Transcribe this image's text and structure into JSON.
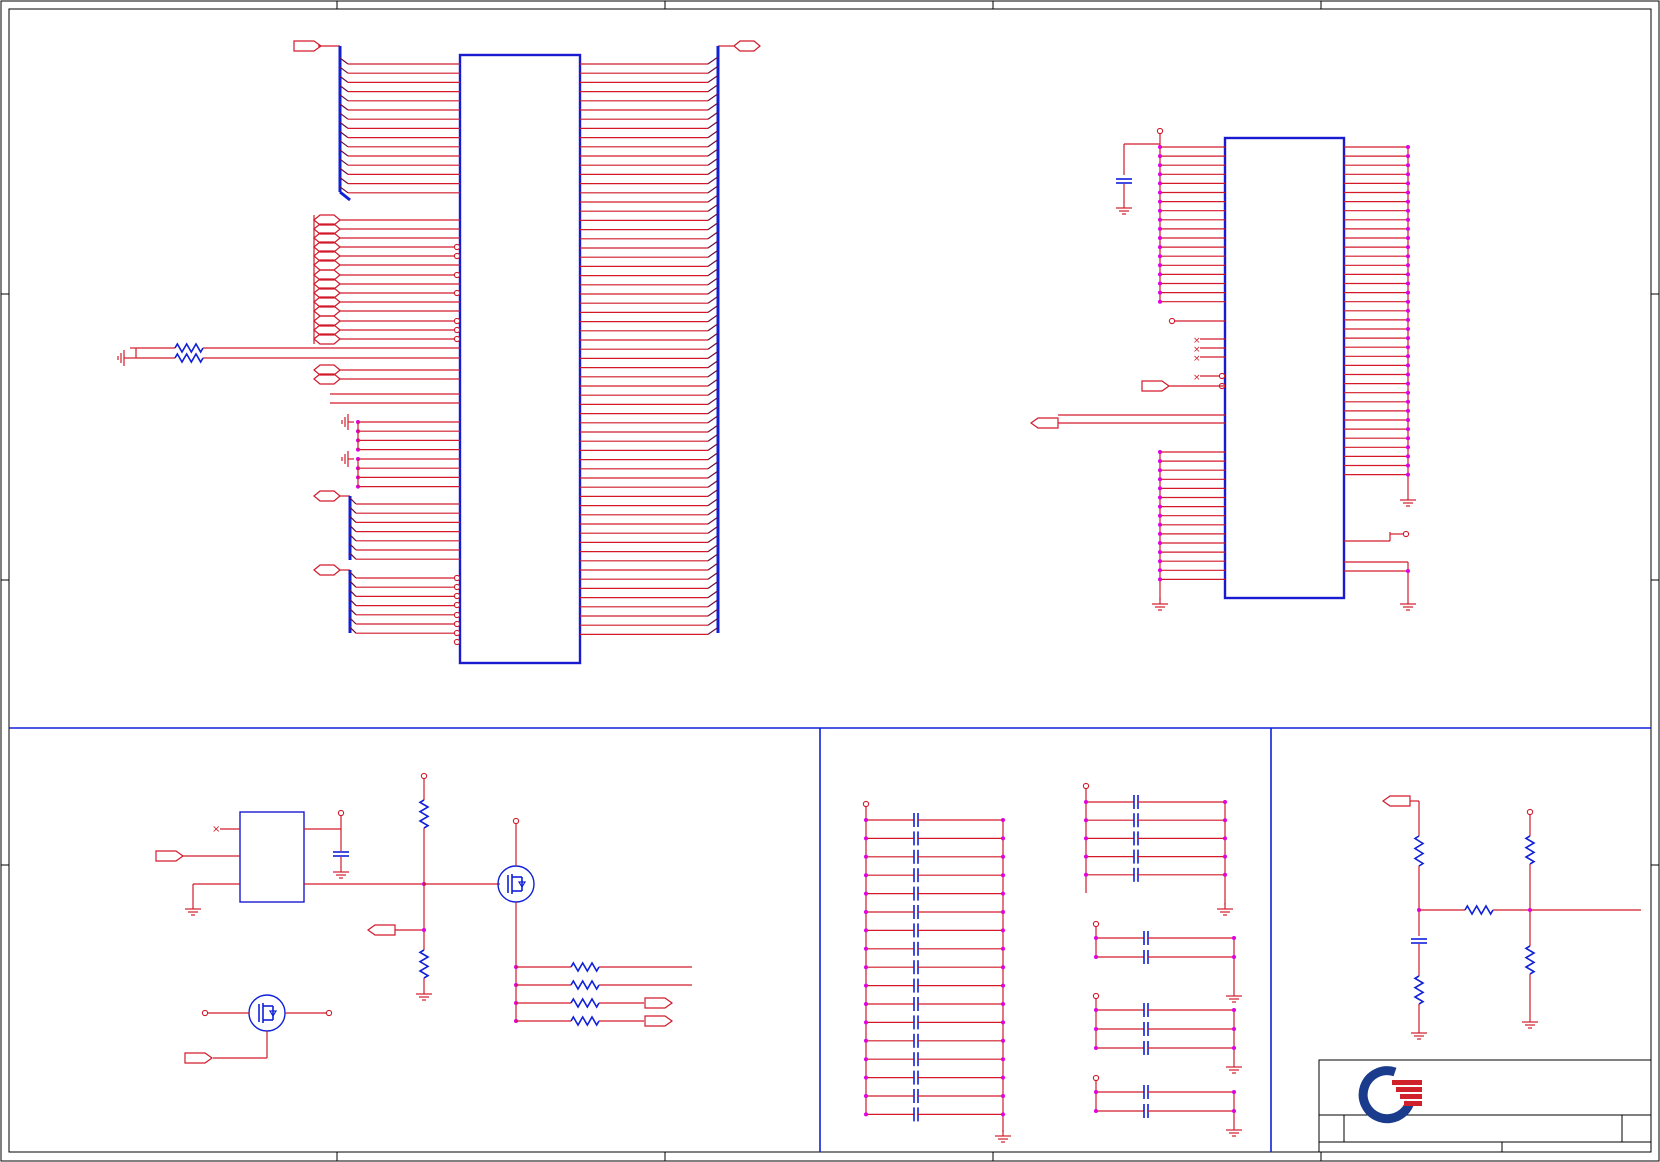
{
  "title": "",
  "colors": {
    "wire": "#d21a2a",
    "net": "#6a1040",
    "symbol": "#1020d8",
    "junction": "#e000e0",
    "logo_blue": "#1b3b8c",
    "logo_red": "#d0202a"
  },
  "icons": [
    "gnd-icon",
    "vcc-icon",
    "resistor-icon",
    "capacitor-icon",
    "mosfet-icon",
    "port-icon",
    "company-logo-icon"
  ]
}
